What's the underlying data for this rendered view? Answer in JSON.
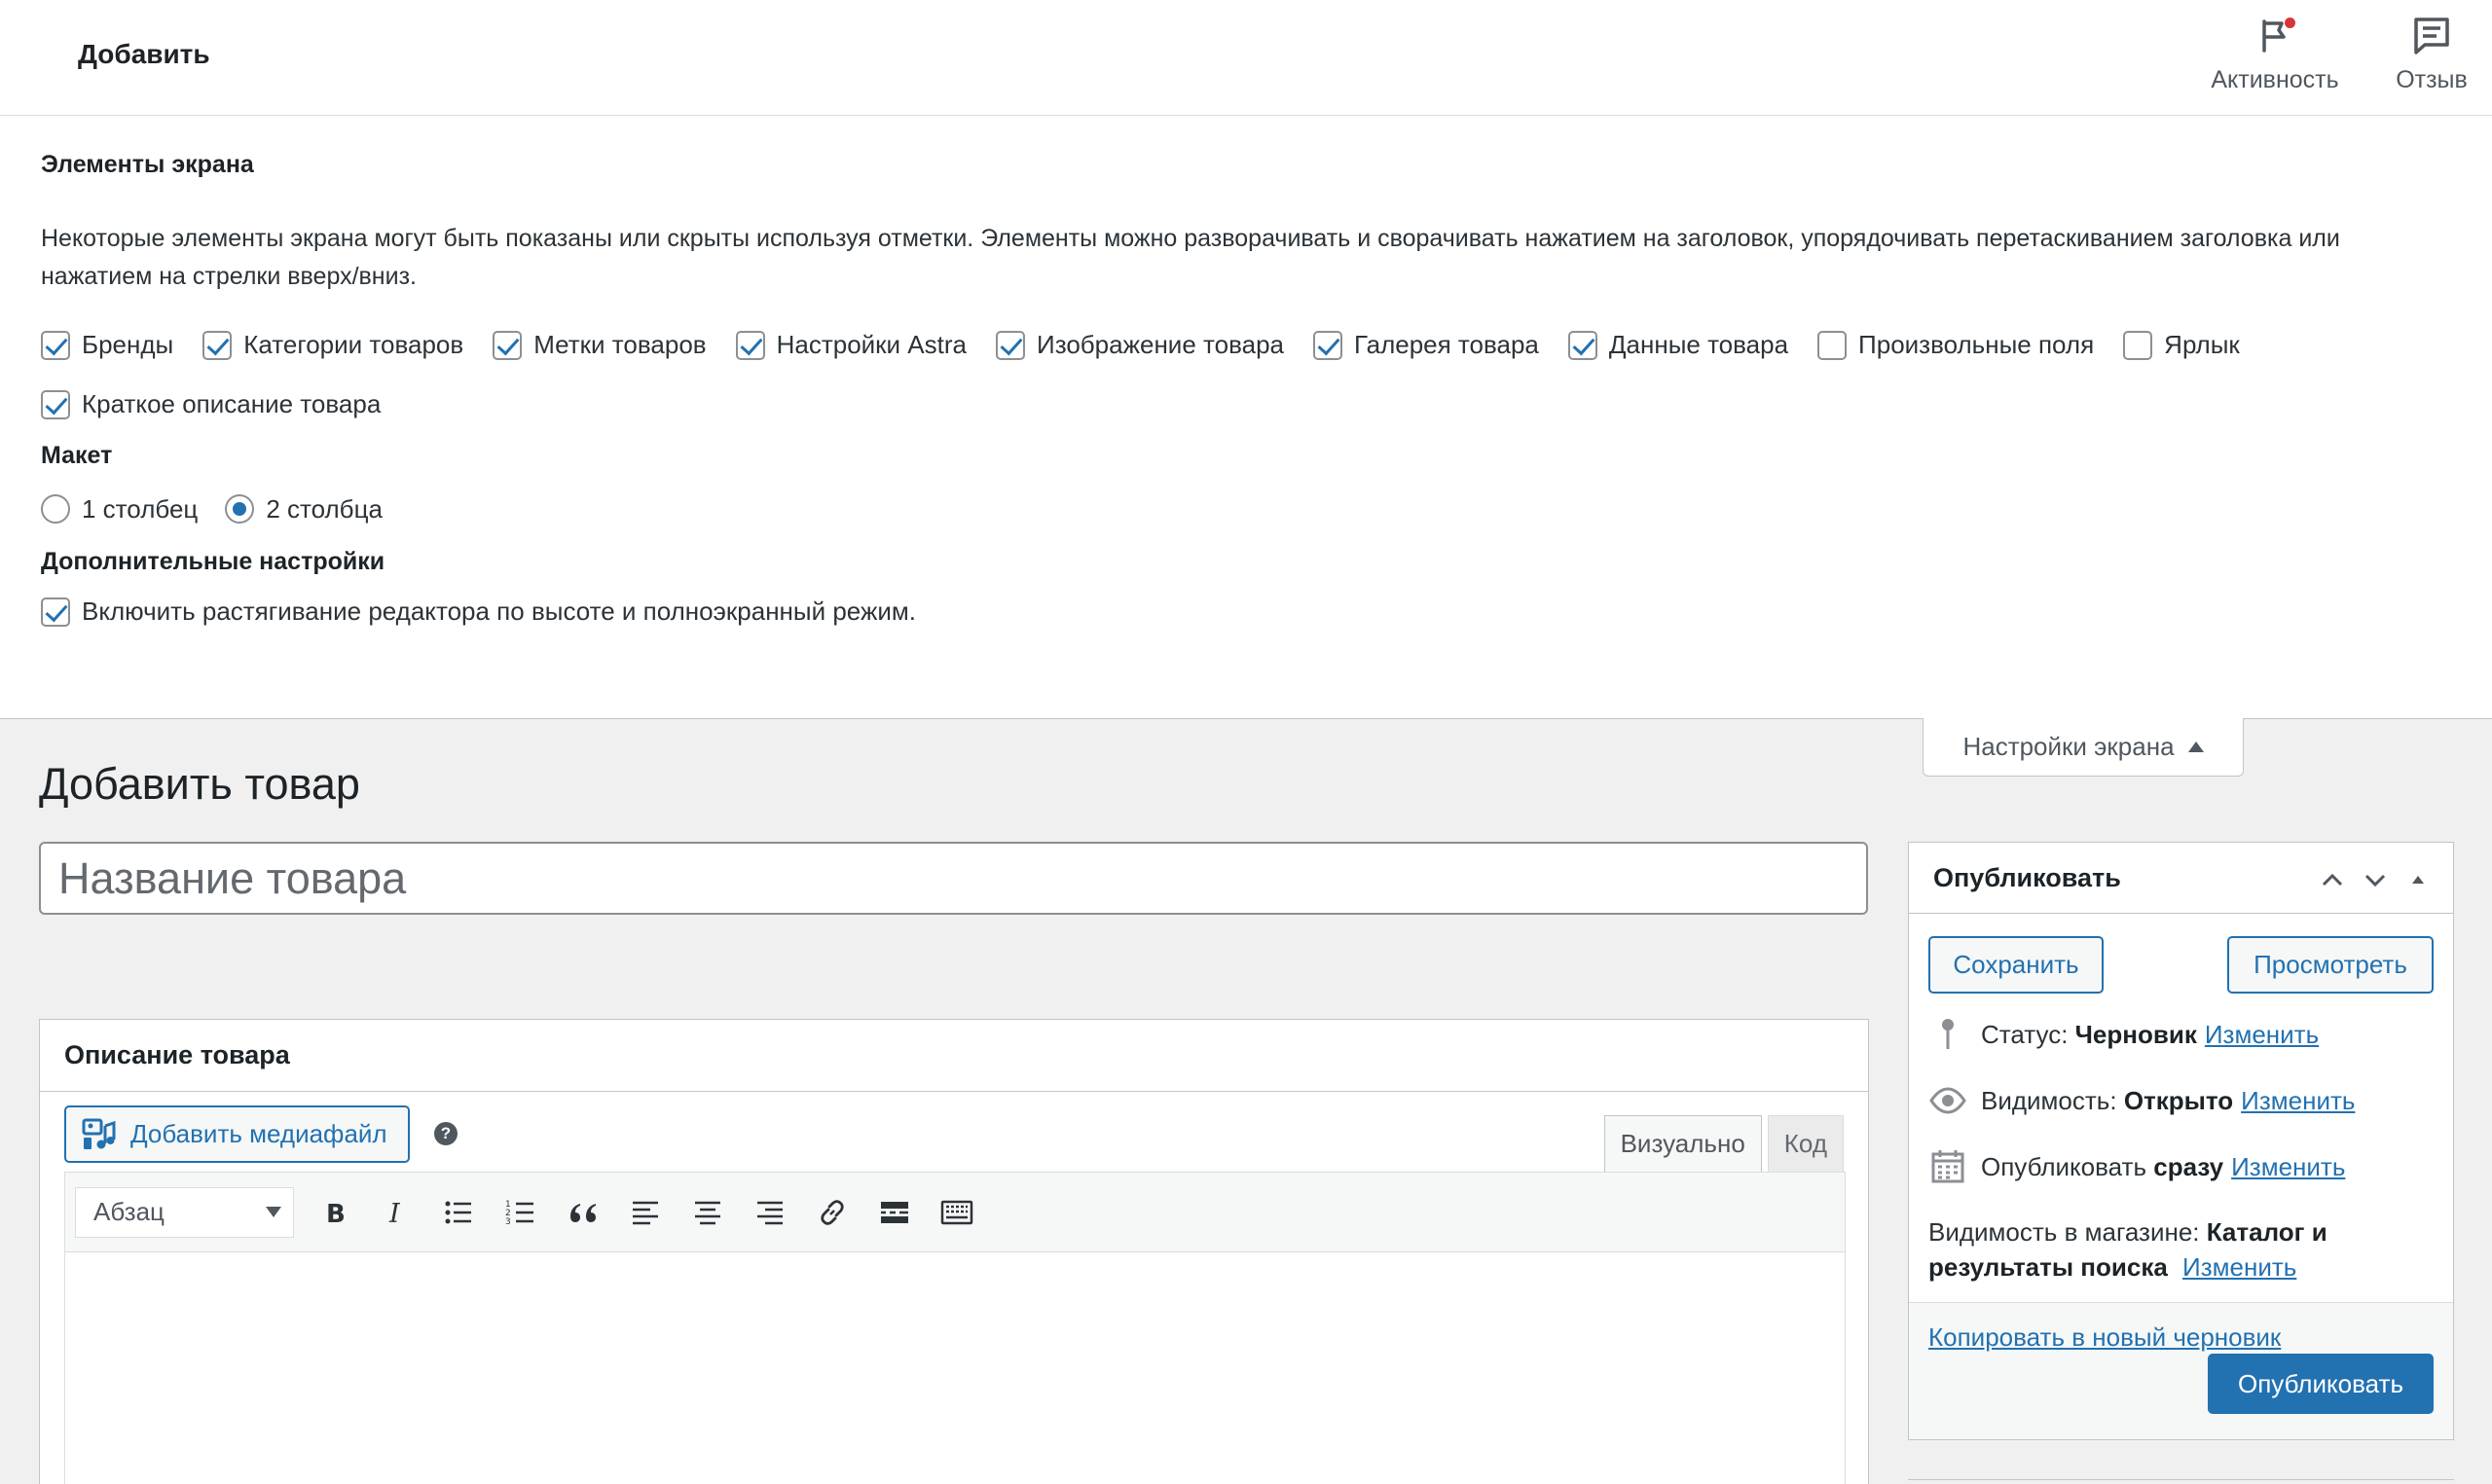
{
  "topbar": {
    "title": "Добавить",
    "activity_label": "Активность",
    "feedback_label": "Отзыв",
    "activity_icon": "flag-icon",
    "feedback_icon": "feedback-icon",
    "notification_color": "#d63638"
  },
  "screen_options": {
    "title": "Элементы экрана",
    "description": "Некоторые элементы экрана могут быть показаны или скрыты используя отметки. Элементы можно разворачивать и сворачивать нажатием на заголовок, упорядочивать перетаскиванием заголовка или нажатием на стрелки вверх/вниз.",
    "items": [
      {
        "label": "Бренды",
        "checked": true
      },
      {
        "label": "Категории товаров",
        "checked": true
      },
      {
        "label": "Метки товаров",
        "checked": true
      },
      {
        "label": "Настройки Astra",
        "checked": true
      },
      {
        "label": "Изображение товара",
        "checked": true
      },
      {
        "label": "Галерея товара",
        "checked": true
      },
      {
        "label": "Данные товара",
        "checked": true
      },
      {
        "label": "Произвольные поля",
        "checked": false
      },
      {
        "label": "Ярлык",
        "checked": false
      },
      {
        "label": "Краткое описание товара",
        "checked": true
      }
    ],
    "layout_title": "Макет",
    "layout_options": [
      {
        "label": "1 столбец",
        "checked": false
      },
      {
        "label": "2 столбца",
        "checked": true
      }
    ],
    "extra_title": "Дополнительные настройки",
    "extra_option": {
      "label": "Включить растягивание редактора по высоте и полноэкранный режим.",
      "checked": true
    },
    "tab_label": "Настройки экрана"
  },
  "main": {
    "heading": "Добавить товар",
    "title_placeholder": "Название товара",
    "description_box": {
      "title": "Описание товара",
      "add_media_label": "Добавить медиафайл",
      "help_symbol": "?",
      "tab_visual": "Визуально",
      "tab_code": "Код",
      "format_select": "Абзац"
    }
  },
  "publish": {
    "title": "Опубликовать",
    "save_label": "Сохранить",
    "preview_label": "Просмотреть",
    "status_label": "Статус:",
    "status_value": "Черновик",
    "visibility_label": "Видимость:",
    "visibility_value": "Открыто",
    "publish_label": "Опубликовать",
    "publish_value": "сразу",
    "edit_label": "Изменить",
    "catalog_label": "Видимость в магазине:",
    "catalog_value": "Каталог и результаты поиска",
    "copy_label": "Копировать в новый черновик",
    "publish_button": "Опубликовать",
    "primary_color": "#2271b1"
  }
}
